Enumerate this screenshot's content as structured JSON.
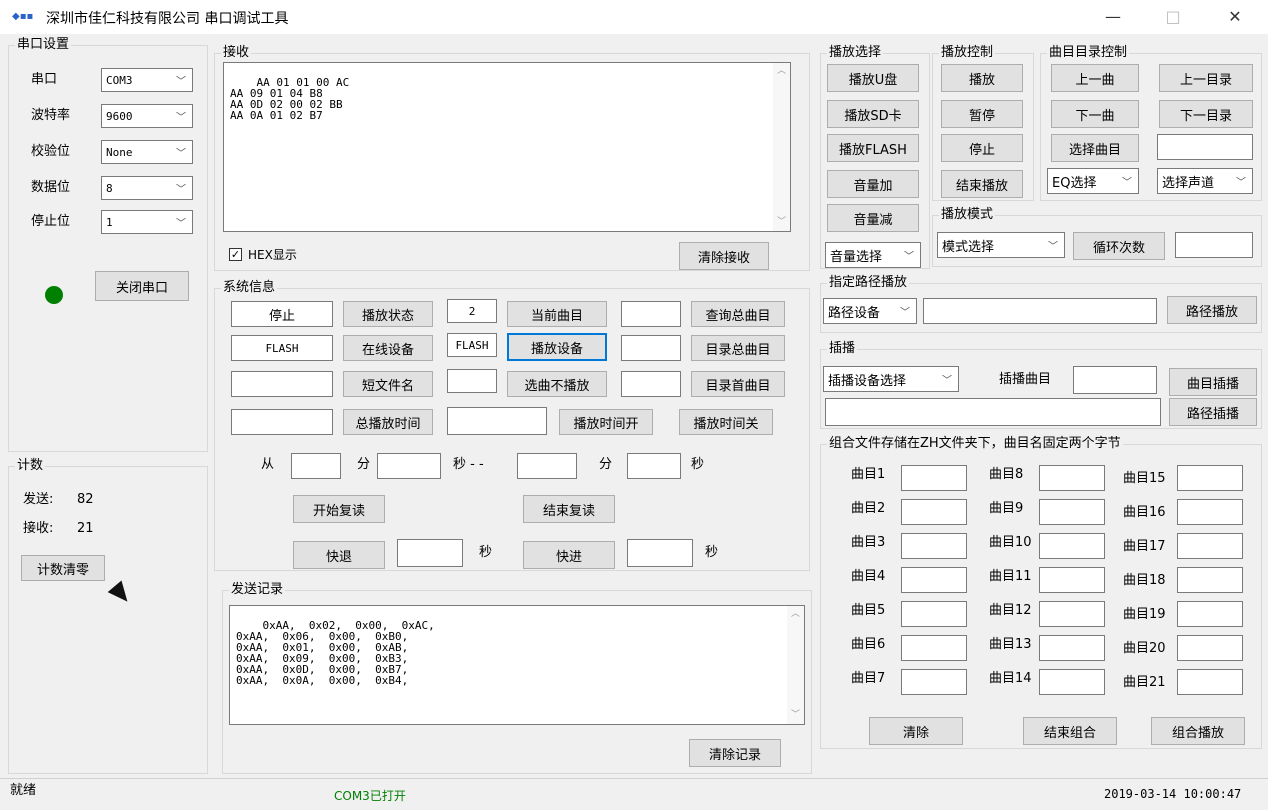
{
  "window": {
    "title": "深圳市佳仁科技有限公司 串口调试工具",
    "icon": "app-icon",
    "minimize": "—",
    "maximize": "□",
    "close": "✕"
  },
  "serial": {
    "legend": "串口设置",
    "port_label": "串口",
    "port_value": "COM3",
    "baud_label": "波特率",
    "baud_value": "9600",
    "parity_label": "校验位",
    "parity_value": "None",
    "databits_label": "数据位",
    "databits_value": "8",
    "stopbits_label": "停止位",
    "stopbits_value": "1",
    "status_color": "#008000",
    "close_port": "关闭串口"
  },
  "count": {
    "legend": "计数",
    "sent_label": "发送:",
    "sent_value": "82",
    "recv_label": "接收:",
    "recv_value": "21",
    "clear": "计数清零"
  },
  "receive": {
    "legend": "接收",
    "lines": "AA 01 01 00 AC\nAA 09 01 04 B8\nAA 0D 02 00 02 BB\nAA 0A 01 02 B7",
    "hex_label": "HEX显示",
    "hex_checked": true,
    "clear": "清除接收"
  },
  "sysinfo": {
    "legend": "系统信息",
    "stop_value": "停止",
    "play_state": "播放状态",
    "cur_track_value": "2",
    "cur_track": "当前曲目",
    "cur_track_field": "",
    "query_total": "查询总曲目",
    "online_value": "FLASH",
    "online_device": "在线设备",
    "play_device_value": "FLASH",
    "play_device": "播放设备",
    "play_device_field": "",
    "dir_total": "目录总曲目",
    "short_name_field": "",
    "short_name": "短文件名",
    "select_field": "",
    "select_noplay": "选曲不播放",
    "dir_first_field": "",
    "dir_first": "目录首曲目",
    "total_time_field": "",
    "total_time": "总播放时间",
    "time_field": "",
    "time_on": "播放时间开",
    "time_off": "播放时间关",
    "from": "从",
    "min1": "分",
    "sec_dash": "秒 - -",
    "min2": "分",
    "sec2": "秒",
    "start_repeat": "开始复读",
    "end_repeat": "结束复读",
    "rewind": "快退",
    "sec3": "秒",
    "forward": "快进",
    "sec4": "秒"
  },
  "sendlog": {
    "legend": "发送记录",
    "lines": "0xAA,  0x02,  0x00,  0xAC,\n0xAA,  0x06,  0x00,  0xB0,\n0xAA,  0x01,  0x00,  0xAB,\n0xAA,  0x09,  0x00,  0xB3,\n0xAA,  0x0D,  0x00,  0xB7,\n0xAA,  0x0A,  0x00,  0xB4,",
    "clear": "清除记录"
  },
  "playsel": {
    "legend": "播放选择",
    "udisk": "播放U盘",
    "sd": "播放SD卡",
    "flash": "播放FLASH",
    "vol_up": "音量加",
    "vol_down": "音量减",
    "vol_select": "音量选择"
  },
  "playctl": {
    "legend": "播放控制",
    "play": "播放",
    "pause": "暂停",
    "stop": "停止",
    "end": "结束播放"
  },
  "dirctl": {
    "legend": "曲目目录控制",
    "prev_track": "上一曲",
    "prev_dir": "上一目录",
    "next_track": "下一曲",
    "next_dir": "下一目录",
    "select_track": "选择曲目",
    "select_field": "",
    "eq": "EQ选择",
    "channel": "选择声道"
  },
  "mode": {
    "legend": "播放模式",
    "select": "模式选择",
    "loop": "循环次数",
    "loop_field": ""
  },
  "path": {
    "legend": "指定路径播放",
    "device": "路径设备",
    "field": "",
    "play": "路径播放"
  },
  "insert": {
    "legend": "插播",
    "device": "插播设备选择",
    "track_label": "插播曲目",
    "track_field": "",
    "track_play": "曲目插播",
    "path_field": "",
    "path_play": "路径插播"
  },
  "combo": {
    "legend": "组合文件存储在ZH文件夹下，曲目名固定两个字节",
    "col1": [
      "曲目1",
      "曲目2",
      "曲目3",
      "曲目4",
      "曲目5",
      "曲目6",
      "曲目7"
    ],
    "col2": [
      "曲目8",
      "曲目9",
      "曲目10",
      "曲目11",
      "曲目12",
      "曲目13",
      "曲目14"
    ],
    "col3": [
      "曲目15",
      "曲目16",
      "曲目17",
      "曲目18",
      "曲目19",
      "曲目20",
      "曲目21"
    ],
    "clear": "清除",
    "end": "结束组合",
    "play": "组合播放"
  },
  "status": {
    "ready": "就绪",
    "port": "COM3已打开",
    "port_color": "#008000",
    "datetime": "2019-03-14  10:00:47"
  }
}
